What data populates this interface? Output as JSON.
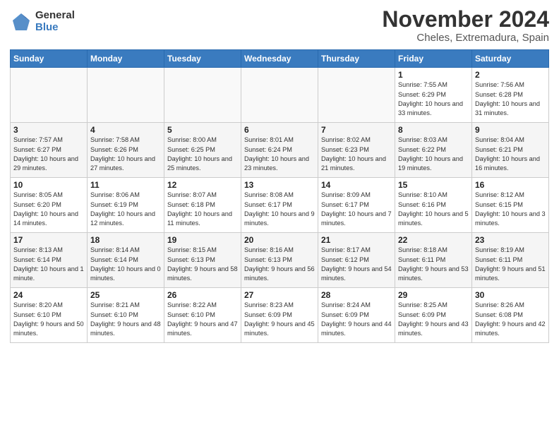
{
  "logo": {
    "general": "General",
    "blue": "Blue"
  },
  "title": "November 2024",
  "location": "Cheles, Extremadura, Spain",
  "days_of_week": [
    "Sunday",
    "Monday",
    "Tuesday",
    "Wednesday",
    "Thursday",
    "Friday",
    "Saturday"
  ],
  "weeks": [
    [
      {
        "day": "",
        "info": ""
      },
      {
        "day": "",
        "info": ""
      },
      {
        "day": "",
        "info": ""
      },
      {
        "day": "",
        "info": ""
      },
      {
        "day": "",
        "info": ""
      },
      {
        "day": "1",
        "info": "Sunrise: 7:55 AM\nSunset: 6:29 PM\nDaylight: 10 hours and 33 minutes."
      },
      {
        "day": "2",
        "info": "Sunrise: 7:56 AM\nSunset: 6:28 PM\nDaylight: 10 hours and 31 minutes."
      }
    ],
    [
      {
        "day": "3",
        "info": "Sunrise: 7:57 AM\nSunset: 6:27 PM\nDaylight: 10 hours and 29 minutes."
      },
      {
        "day": "4",
        "info": "Sunrise: 7:58 AM\nSunset: 6:26 PM\nDaylight: 10 hours and 27 minutes."
      },
      {
        "day": "5",
        "info": "Sunrise: 8:00 AM\nSunset: 6:25 PM\nDaylight: 10 hours and 25 minutes."
      },
      {
        "day": "6",
        "info": "Sunrise: 8:01 AM\nSunset: 6:24 PM\nDaylight: 10 hours and 23 minutes."
      },
      {
        "day": "7",
        "info": "Sunrise: 8:02 AM\nSunset: 6:23 PM\nDaylight: 10 hours and 21 minutes."
      },
      {
        "day": "8",
        "info": "Sunrise: 8:03 AM\nSunset: 6:22 PM\nDaylight: 10 hours and 19 minutes."
      },
      {
        "day": "9",
        "info": "Sunrise: 8:04 AM\nSunset: 6:21 PM\nDaylight: 10 hours and 16 minutes."
      }
    ],
    [
      {
        "day": "10",
        "info": "Sunrise: 8:05 AM\nSunset: 6:20 PM\nDaylight: 10 hours and 14 minutes."
      },
      {
        "day": "11",
        "info": "Sunrise: 8:06 AM\nSunset: 6:19 PM\nDaylight: 10 hours and 12 minutes."
      },
      {
        "day": "12",
        "info": "Sunrise: 8:07 AM\nSunset: 6:18 PM\nDaylight: 10 hours and 11 minutes."
      },
      {
        "day": "13",
        "info": "Sunrise: 8:08 AM\nSunset: 6:17 PM\nDaylight: 10 hours and 9 minutes."
      },
      {
        "day": "14",
        "info": "Sunrise: 8:09 AM\nSunset: 6:17 PM\nDaylight: 10 hours and 7 minutes."
      },
      {
        "day": "15",
        "info": "Sunrise: 8:10 AM\nSunset: 6:16 PM\nDaylight: 10 hours and 5 minutes."
      },
      {
        "day": "16",
        "info": "Sunrise: 8:12 AM\nSunset: 6:15 PM\nDaylight: 10 hours and 3 minutes."
      }
    ],
    [
      {
        "day": "17",
        "info": "Sunrise: 8:13 AM\nSunset: 6:14 PM\nDaylight: 10 hours and 1 minute."
      },
      {
        "day": "18",
        "info": "Sunrise: 8:14 AM\nSunset: 6:14 PM\nDaylight: 10 hours and 0 minutes."
      },
      {
        "day": "19",
        "info": "Sunrise: 8:15 AM\nSunset: 6:13 PM\nDaylight: 9 hours and 58 minutes."
      },
      {
        "day": "20",
        "info": "Sunrise: 8:16 AM\nSunset: 6:13 PM\nDaylight: 9 hours and 56 minutes."
      },
      {
        "day": "21",
        "info": "Sunrise: 8:17 AM\nSunset: 6:12 PM\nDaylight: 9 hours and 54 minutes."
      },
      {
        "day": "22",
        "info": "Sunrise: 8:18 AM\nSunset: 6:11 PM\nDaylight: 9 hours and 53 minutes."
      },
      {
        "day": "23",
        "info": "Sunrise: 8:19 AM\nSunset: 6:11 PM\nDaylight: 9 hours and 51 minutes."
      }
    ],
    [
      {
        "day": "24",
        "info": "Sunrise: 8:20 AM\nSunset: 6:10 PM\nDaylight: 9 hours and 50 minutes."
      },
      {
        "day": "25",
        "info": "Sunrise: 8:21 AM\nSunset: 6:10 PM\nDaylight: 9 hours and 48 minutes."
      },
      {
        "day": "26",
        "info": "Sunrise: 8:22 AM\nSunset: 6:10 PM\nDaylight: 9 hours and 47 minutes."
      },
      {
        "day": "27",
        "info": "Sunrise: 8:23 AM\nSunset: 6:09 PM\nDaylight: 9 hours and 45 minutes."
      },
      {
        "day": "28",
        "info": "Sunrise: 8:24 AM\nSunset: 6:09 PM\nDaylight: 9 hours and 44 minutes."
      },
      {
        "day": "29",
        "info": "Sunrise: 8:25 AM\nSunset: 6:09 PM\nDaylight: 9 hours and 43 minutes."
      },
      {
        "day": "30",
        "info": "Sunrise: 8:26 AM\nSunset: 6:08 PM\nDaylight: 9 hours and 42 minutes."
      }
    ]
  ]
}
